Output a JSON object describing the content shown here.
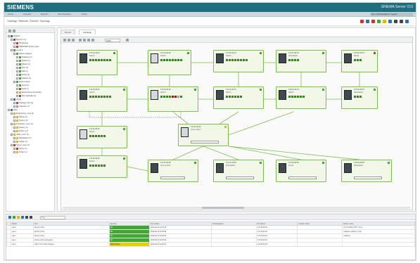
{
  "app": {
    "brand": "SIEMENS",
    "product": "SINEMA Server V13"
  },
  "menu": {
    "items": [
      "Home",
      "Network",
      "Reports",
      "Administration",
      "Setup"
    ],
    "user": "user / Administrator / Logout"
  },
  "breadcrumb": "Topology / Network / Subnet / Topology",
  "toolbar_colors": [
    "#d0302c",
    "#2b6fb7",
    "#d0302c",
    "#3fa92f",
    "#e6b300",
    "#2b6fb7",
    "#444444",
    "#444444",
    "#2b6fb7"
  ],
  "tree": [
    {
      "label": "Network",
      "depth": 0,
      "color": "#2b6fb7"
    },
    {
      "label": "Subnet 1 (1)",
      "depth": 1,
      "color": "#d0302c"
    },
    {
      "label": "PN devices",
      "depth": 2,
      "color": "#d0302c"
    },
    {
      "label": "PROFINET device name",
      "depth": 2,
      "color": "#d0302c"
    },
    {
      "label": "Group A",
      "depth": 1,
      "color": "#3fa92f"
    },
    {
      "label": "Device category",
      "depth": 2,
      "color": "#3fa92f"
    },
    {
      "label": "Scalance (2)",
      "depth": 3,
      "color": "#3fa92f"
    },
    {
      "label": "Switch (2)",
      "depth": 3,
      "color": "#3fa92f"
    },
    {
      "label": "Router (1)",
      "depth": 3,
      "color": "#3fa92f"
    },
    {
      "label": "PLC (3)",
      "depth": 3,
      "color": "#3fa92f"
    },
    {
      "label": "HMI (1)",
      "depth": 3,
      "color": "#3fa92f"
    },
    {
      "label": "Drives (2)",
      "depth": 3,
      "color": "#3fa92f"
    },
    {
      "label": "Stations (1)",
      "depth": 3,
      "color": "#3fa92f"
    },
    {
      "label": "Device status",
      "depth": 2,
      "color": "#3fa92f"
    },
    {
      "label": "Good (7)",
      "depth": 3,
      "color": "#3fa92f"
    },
    {
      "label": "Fault (1)",
      "depth": 3,
      "color": "#d0302c"
    },
    {
      "label": "Maintenance demanded",
      "depth": 3,
      "color": "#e6b300"
    },
    {
      "label": "Not reachable (1)",
      "depth": 3,
      "color": "#d0302c"
    },
    {
      "label": "Views",
      "depth": 1,
      "color": "#2b6fb7"
    },
    {
      "label": "Topology view (1)",
      "depth": 2,
      "color": "#d0302c"
    },
    {
      "label": "Unknown (1)",
      "depth": 2,
      "color": "#999999"
    },
    {
      "label": "Sites",
      "depth": 0,
      "color": "#2b6fb7"
    },
    {
      "label": "Engineering_room (1)",
      "depth": 1,
      "color": "#e6b300"
    },
    {
      "label": "Device (1)",
      "depth": 2,
      "color": "#e6b300"
    },
    {
      "label": "Device_(2)",
      "depth": 2,
      "color": "#e6b300"
    },
    {
      "label": "Production_room (1)",
      "depth": 1,
      "color": "#e6b300"
    },
    {
      "label": "Device_(1)",
      "depth": 2,
      "color": "#e6b300"
    },
    {
      "label": "Device_(3)",
      "depth": 2,
      "color": "#e6b300"
    },
    {
      "label": "Office_room (1)",
      "depth": 1,
      "color": "#e6b300"
    },
    {
      "label": "Workstation (1)",
      "depth": 2,
      "color": "#e6b300"
    },
    {
      "label": "Laptop (1)",
      "depth": 2,
      "color": "#e6b300"
    },
    {
      "label": "Server_room (1)",
      "depth": 1,
      "color": "#d0302c"
    },
    {
      "label": "Server (1)",
      "depth": 2,
      "color": "#d0302c"
    },
    {
      "label": "Printer (1)",
      "depth": 2,
      "color": "#e6b300"
    }
  ],
  "tabs": [
    "Device",
    "Topology"
  ],
  "canvas": {
    "zoom": "100%"
  },
  "nodes": [
    {
      "id": "n1",
      "title": "172.16.40.21",
      "sub": "Switch",
      "ports": [
        "g",
        "g",
        "g",
        "g",
        "g",
        "g",
        "g",
        "g"
      ],
      "dark": true,
      "flag": "#3fa92f",
      "bar": 40
    },
    {
      "id": "n2",
      "title": "172.16.40.22",
      "sub": "Switch",
      "ports": [
        "g",
        "g",
        "g",
        "g",
        "g",
        "g",
        "g",
        "g"
      ],
      "dark": false,
      "flag": "#3fa92f",
      "bar": 40
    },
    {
      "id": "n3",
      "title": "172.16.40.23",
      "sub": "Switch",
      "ports": [
        "g",
        "g",
        "g",
        "g",
        "g",
        "g",
        "g",
        "g"
      ],
      "dark": true,
      "flag": "#3fa92f",
      "bar": 40
    },
    {
      "id": "n4",
      "title": "172.16.40.24",
      "sub": "Workstation",
      "ports": [
        "g",
        "g",
        "g",
        "g"
      ],
      "dark": true,
      "flag": "#3fa92f",
      "bar": 40
    },
    {
      "id": "n5",
      "title": "172.16.40.25",
      "sub": "Router",
      "ports": [
        "g",
        "g",
        "g"
      ],
      "dark": true,
      "flag": "#d0302c",
      "bar": 30
    },
    {
      "id": "n6",
      "title": "172.16.40.31",
      "sub": "Switch",
      "ports": [
        "g",
        "g",
        "g",
        "g",
        "g",
        "g",
        "g",
        "g"
      ],
      "dark": true,
      "flag": "#3fa92f",
      "bar": 40
    },
    {
      "id": "n7",
      "title": "172.16.40.32",
      "sub": "Switch",
      "ports": [
        "g",
        "g",
        "g",
        "g",
        "r",
        "r",
        "gr",
        "g"
      ],
      "dark": false,
      "flag": "#3fa92f",
      "bar": 40
    },
    {
      "id": "n8",
      "title": "172.16.40.33",
      "sub": "Switch",
      "ports": [
        "g",
        "g",
        "g",
        "g",
        "g",
        "g"
      ],
      "dark": true,
      "flag": "#3fa92f",
      "bar": 40
    },
    {
      "id": "n9",
      "title": "172.16.40.34",
      "sub": "Switch",
      "ports": [
        "g",
        "g",
        "g",
        "g",
        "g",
        "g"
      ],
      "dark": true,
      "flag": "#3fa92f",
      "bar": 40
    },
    {
      "id": "n10",
      "title": "172.16.40.35",
      "sub": "Workstation",
      "ports": [
        "g",
        "g",
        "g"
      ],
      "dark": true,
      "flag": "#3fa92f",
      "bar": 30
    },
    {
      "id": "n11",
      "title": "172.16.40.41",
      "sub": "Switch",
      "ports": [
        "g",
        "g",
        "g",
        "g",
        "g",
        "g"
      ],
      "dark": false,
      "flag": "#3fa92f",
      "bar": 40
    },
    {
      "id": "n12",
      "title": "172.16.40.42",
      "sub": "Access Point",
      "ports": [],
      "dark": false,
      "flag": "#e6b300",
      "bar": 40
    },
    {
      "id": "n13",
      "title": "172.16.40.51",
      "sub": "Switch",
      "ports": [
        "g",
        "g",
        "g",
        "g",
        "g",
        "g"
      ],
      "dark": true,
      "flag": "#3fa92f",
      "bar": 40
    },
    {
      "id": "n14",
      "title": "172.16.40.52",
      "sub": "Access Point",
      "ports": [],
      "dark": true,
      "flag": "#3fa92f",
      "bar": 35
    },
    {
      "id": "n15",
      "title": "172.16.40.53",
      "sub": "Workstation",
      "ports": [],
      "dark": true,
      "flag": "#3fa92f",
      "bar": 40
    },
    {
      "id": "n16",
      "title": "172.16.40.54",
      "sub": "Server",
      "ports": [],
      "dark": true,
      "flag": "#3fa92f",
      "bar": 40
    },
    {
      "id": "n17",
      "title": "172.16.40.55",
      "sub": "Workstation",
      "ports": [],
      "dark": true,
      "flag": "#3fa92f",
      "bar": 40
    }
  ],
  "events": {
    "filter_placeholder": "Filter",
    "columns": [
      "",
      "Status",
      "Text",
      "Severity",
      "Time stamp",
      "Acknowledged",
      "IP address",
      "Location name",
      "Device name"
    ],
    "rows": [
      {
        "status": "open",
        "text": "Device is fine",
        "severity": "OK",
        "sev": "ok",
        "time": "2016-02-14 12:34:45",
        "ack": "",
        "ip": "172.16.40.31",
        "loc": "",
        "dev": "plc-S7-1500 / PN 7 / S-E"
      },
      {
        "status": "open",
        "text": "Device is fine",
        "severity": "OK",
        "sev": "ok",
        "time": "2016-02-14 12:35:05",
        "ack": "",
        "ip": "172.16.40.32",
        "loc": "",
        "dev": "scalance-switch-1 / S-E"
      },
      {
        "status": "open",
        "text": "Device is fine",
        "severity": "OK",
        "sev": "ok",
        "time": "2016-02-14 12:35:19",
        "ack": "",
        "ip": "172.16.40.23",
        "loc": "",
        "dev": "scalance"
      },
      {
        "status": "open",
        "text": "Device is fine (changed)",
        "severity": "OK",
        "sev": "ok",
        "time": "2016-02-14 12:35:44",
        "ack": "",
        "ip": "172.16.40.24",
        "loc": "",
        "dev": ""
      },
      {
        "status": "open",
        "text": "Alarm: Port state changed",
        "severity": "Maintenance",
        "sev": "warn",
        "time": "2016-02-14 12:36:02",
        "ack": "",
        "ip": "172.16.40.25",
        "loc": "",
        "dev": ""
      }
    ]
  }
}
